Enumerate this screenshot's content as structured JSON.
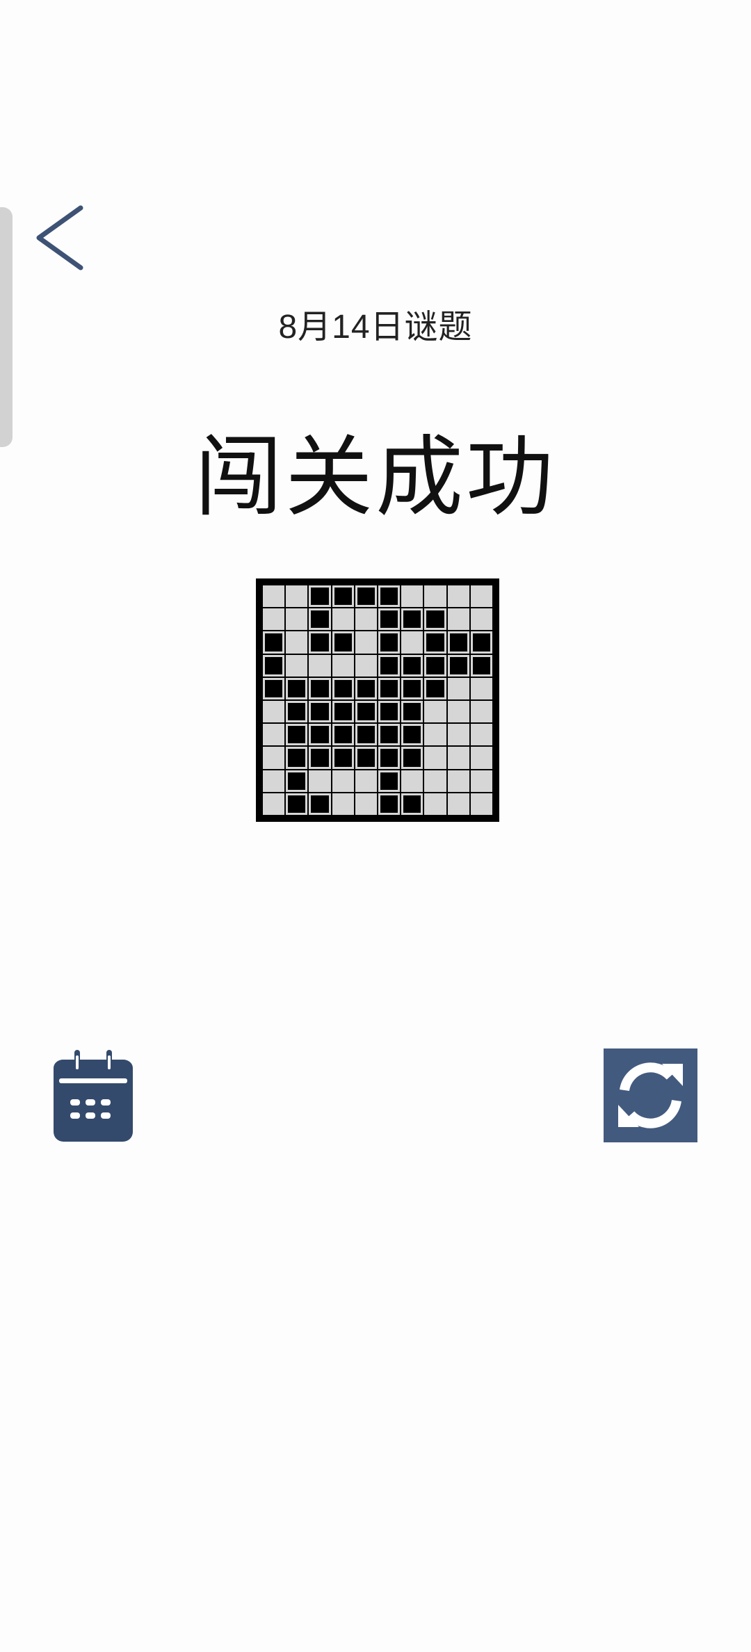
{
  "header": {
    "back_icon": "chevron-left-icon",
    "subtitle": "8月14日谜题",
    "title": "闯关成功"
  },
  "puzzle": {
    "rows": 10,
    "cols": 10,
    "cells": [
      [
        0,
        0,
        1,
        1,
        1,
        1,
        0,
        0,
        0,
        0
      ],
      [
        0,
        0,
        1,
        0,
        0,
        1,
        1,
        1,
        0,
        0
      ],
      [
        1,
        0,
        1,
        1,
        0,
        1,
        0,
        1,
        1,
        1
      ],
      [
        1,
        0,
        0,
        0,
        0,
        1,
        1,
        1,
        1,
        1
      ],
      [
        1,
        1,
        1,
        1,
        1,
        1,
        1,
        1,
        0,
        0
      ],
      [
        0,
        1,
        1,
        1,
        1,
        1,
        1,
        0,
        0,
        0
      ],
      [
        0,
        1,
        1,
        1,
        1,
        1,
        1,
        0,
        0,
        0
      ],
      [
        0,
        1,
        1,
        1,
        1,
        1,
        1,
        0,
        0,
        0
      ],
      [
        0,
        1,
        0,
        0,
        0,
        1,
        0,
        0,
        0,
        0
      ],
      [
        0,
        1,
        1,
        0,
        0,
        1,
        1,
        0,
        0,
        0
      ]
    ]
  },
  "actions": {
    "calendar_icon": "calendar-icon",
    "refresh_icon": "refresh-icon"
  },
  "colors": {
    "accent": "#435a7f",
    "calendar": "#344a6c",
    "cell_empty": "#d6d6d6",
    "cell_filled": "#000000"
  }
}
